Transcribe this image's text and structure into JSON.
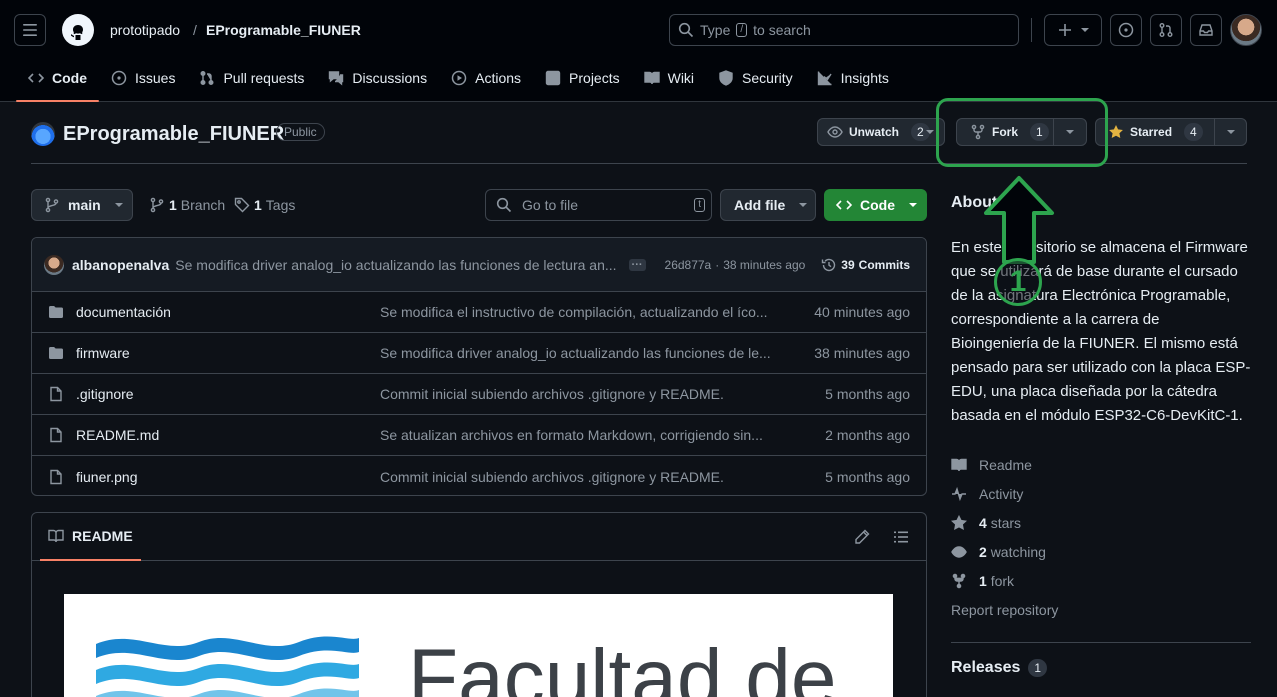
{
  "header": {
    "owner": "prototipado",
    "separator": "/",
    "repo": "EProgramable_FIUNER",
    "search_placeholder": "Type",
    "search_key": "/",
    "search_suffix": "to search"
  },
  "tabs": [
    {
      "label": "Code",
      "icon": "code-icon"
    },
    {
      "label": "Issues",
      "icon": "issue-icon"
    },
    {
      "label": "Pull requests",
      "icon": "pull-request-icon"
    },
    {
      "label": "Discussions",
      "icon": "discussion-icon"
    },
    {
      "label": "Actions",
      "icon": "play-icon"
    },
    {
      "label": "Projects",
      "icon": "table-icon"
    },
    {
      "label": "Wiki",
      "icon": "book-icon"
    },
    {
      "label": "Security",
      "icon": "shield-icon"
    },
    {
      "label": "Insights",
      "icon": "graph-icon"
    }
  ],
  "repo": {
    "name": "EProgramable_FIUNER",
    "visibility": "Public",
    "unwatch_label": "Unwatch",
    "unwatch_count": "2",
    "fork_label": "Fork",
    "fork_count": "1",
    "starred_label": "Starred",
    "starred_count": "4"
  },
  "toolbar": {
    "branch": "main",
    "branches_count": "1",
    "branches_label": "Branch",
    "tags_count": "1",
    "tags_label": "Tags",
    "go_to_file": "Go to file",
    "go_to_file_key": "t",
    "add_file": "Add file",
    "code": "Code"
  },
  "last_commit": {
    "author": "albanopenalva",
    "message": "Se modifica driver analog_io actualizando las funciones de lectura an...",
    "ellipsis": "···",
    "hash": "26d877a",
    "separator": "·",
    "time": "38 minutes ago",
    "commits_count": "39",
    "commits_label": "Commits"
  },
  "files": [
    {
      "name": "documentación",
      "type": "folder",
      "message": "Se modifica el instructivo de compilación, actualizando el íco...",
      "date": "40 minutes ago"
    },
    {
      "name": "firmware",
      "type": "folder",
      "message": "Se modifica driver analog_io actualizando las funciones de le...",
      "date": "38 minutes ago"
    },
    {
      "name": ".gitignore",
      "type": "file",
      "message": "Commit inicial subiendo archivos .gitignore y README.",
      "date": "5 months ago"
    },
    {
      "name": "README.md",
      "type": "file",
      "message": "Se atualizan archivos en formato Markdown, corrigiendo sin...",
      "date": "2 months ago"
    },
    {
      "name": "fiuner.png",
      "type": "file",
      "message": "Commit inicial subiendo archivos .gitignore y README.",
      "date": "5 months ago"
    }
  ],
  "readme": {
    "tab_label": "README",
    "image_text": "Facultad de"
  },
  "about": {
    "title": "About",
    "description": "En este repositorio se almacena el Firmware que se utilizará de base durante el cursado de la asignatura Electrónica Programable, correspondiente a la carrera de Bioingeniería de la FIUNER. El mismo está pensado para ser utilizado con la placa ESP-EDU, una placa diseñada por la cátedra basada en el módulo ESP32-C6-DevKitC-1.",
    "links": [
      {
        "icon": "book-icon",
        "bold": "",
        "label": "Readme"
      },
      {
        "icon": "pulse-icon",
        "bold": "",
        "label": "Activity"
      },
      {
        "icon": "star-icon",
        "bold": "4",
        "label": "stars"
      },
      {
        "icon": "eye-icon",
        "bold": "2",
        "label": "watching"
      },
      {
        "icon": "fork-icon",
        "bold": "1",
        "label": "fork"
      }
    ],
    "report": "Report repository",
    "releases_label": "Releases",
    "releases_count": "1"
  },
  "annotation": {
    "number": "1",
    "color": "#2da44e"
  },
  "colors": {
    "accent_green": "#238636",
    "tab_underline": "#f78166",
    "background": "#0d1117"
  }
}
